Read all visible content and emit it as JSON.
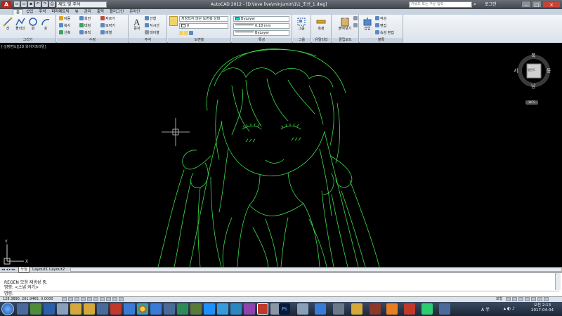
{
  "titlebar": {
    "app_button": "A",
    "workspace": "제도 및 주석",
    "title": "AutoCAD 2012 - [D:\\love live\\minjumin\\1\\1_조선_1.dwg]",
    "search_placeholder": "키워드 또는 구문 입력",
    "login": "로그인",
    "minimize": "–",
    "restore": "□",
    "close": "×"
  },
  "tabs": [
    "홈",
    "삽입",
    "주석",
    "파라메트릭",
    "뷰",
    "관리",
    "출력",
    "플러그인",
    "온라인"
  ],
  "ribbon": {
    "draw": {
      "title": "그리기",
      "line": "선",
      "polyline": "폴리선",
      "circle": "원",
      "arc": "호"
    },
    "modify": {
      "title": "수정",
      "move": "이동",
      "rotate": "회전",
      "trim": "자르기",
      "copy": "복사",
      "mirror": "대칭",
      "fillet": "모깎기",
      "stretch": "신축",
      "scale": "축척",
      "array": "배열"
    },
    "annotation": {
      "title": "주석",
      "text": "문자",
      "linear": "선형",
      "leader": "지시선",
      "table": "테이블"
    },
    "layers": {
      "title": "도면층",
      "layer_state": "저장되지 않은 도면층 상태",
      "layer_current": "0"
    },
    "properties": {
      "title": "특성",
      "color": "ByLayer",
      "lineweight": "0.18 mm",
      "linetype": "ByLayer",
      "cyan_swatch": "#00e5e5"
    },
    "groups": {
      "title": "그룹",
      "group": "그룹"
    },
    "utilities": {
      "title": "유틸리티",
      "measure": "측정"
    },
    "clipboard": {
      "title": "클립보드",
      "paste": "붙여넣기"
    },
    "block": {
      "title": "블록",
      "insert": "삽입",
      "create": "작성",
      "edit": "편집",
      "attr": "속성 편집"
    }
  },
  "viewport": {
    "label": "[-][평면도][2D 와이어프레임]",
    "line_color": "#3ddc4a",
    "viewcube": {
      "n": "북",
      "s": "남",
      "e": "동",
      "w": "서",
      "top": "평면도",
      "wcs": "WCS"
    }
  },
  "layout_tabs": [
    "모형",
    "Layout1",
    "Layout2"
  ],
  "command": {
    "lines": [
      "REGEN 모형 재생성 중.",
      "명령: <스냅 켜기>"
    ],
    "prompt": "명령:"
  },
  "status": {
    "coords": "128.3890, 261.9465, 0.0000",
    "model": "모형"
  },
  "taskbar": {
    "clock_time": "오전 2:13",
    "clock_date": "2017-04-04",
    "lang": "A 半"
  }
}
